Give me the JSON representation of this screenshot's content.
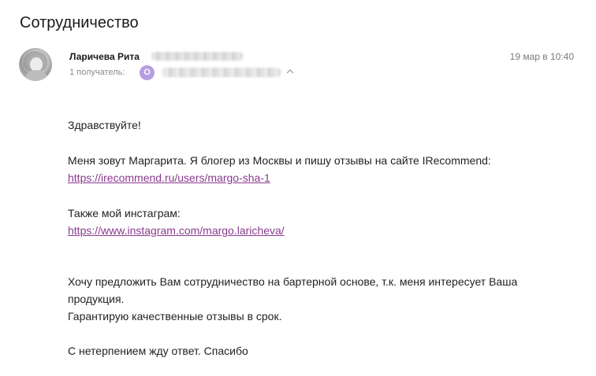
{
  "subject": "Сотрудничество",
  "sender": {
    "name": "Ларичева Рита"
  },
  "date": "19 мар в 10:40",
  "recipients": {
    "label": "1 получатель:",
    "avatar_letter": "О"
  },
  "colors": {
    "link": "#8a3a8f",
    "recipient_avatar": "#b69ce0"
  },
  "icons": {
    "collapse": "chevron-up-icon"
  },
  "message": {
    "greeting": "Здравствуйте!",
    "intro": "Меня зовут Маргарита. Я блогер из Москвы и пишу отзывы на сайте IRecommend:",
    "irecommend_link": "https://irecommend.ru/users/margo-sha-1",
    "instagram_label": "Также мой инстаграм:",
    "instagram_link": "https://www.instagram.com/margo.laricheva/",
    "offer_line1": "Хочу предложить Вам сотрудничество на бартерной основе, т.к. меня интересует Ваша",
    "offer_line2": "продукция.",
    "guarantee": "Гарантирую качественные отзывы в срок.",
    "closing": "С нетерпением жду ответ. Спасибо"
  }
}
